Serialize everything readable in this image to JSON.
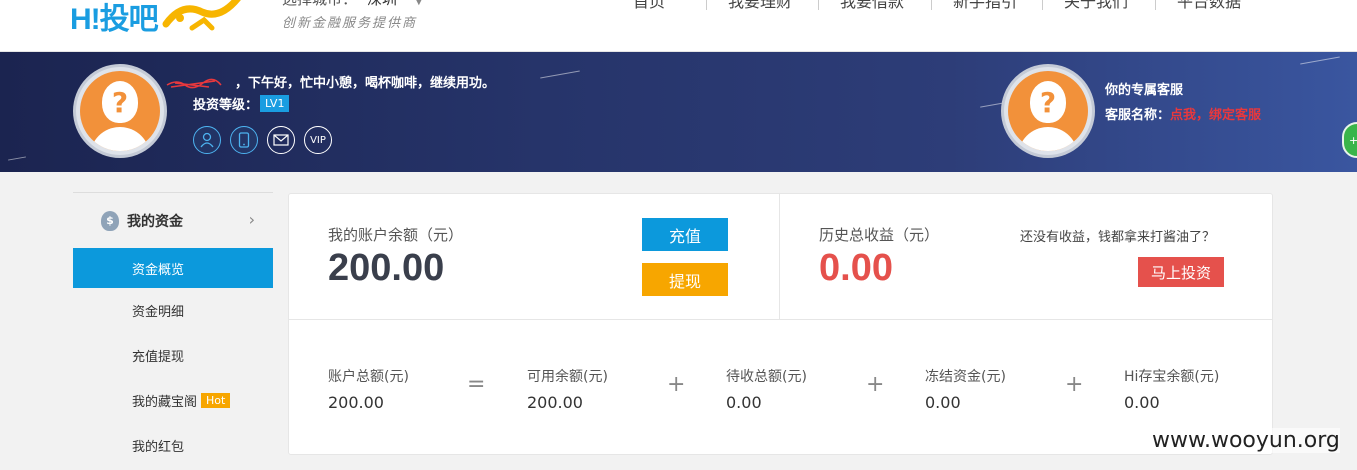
{
  "header": {
    "logo_text": "H!投吧",
    "city_label": "选择城市：",
    "city_value": "深圳",
    "slogan": "创新金融服务提供商",
    "nav": [
      "首页",
      "我要理财",
      "我要借款",
      "新手指引",
      "关于我们",
      "平台数据"
    ]
  },
  "banner": {
    "greeting": "，下午好，忙中小憩，喝杯咖啡，继续用功。",
    "level_label": "投资等级：",
    "level_value": "LV1",
    "vip_label": "VIP",
    "cs_title": "你的专属客服",
    "cs_name_label": "客服名称：",
    "cs_name_value": "点我，绑定客服",
    "side_tab": "+"
  },
  "sidebar": {
    "header": "我的资金",
    "items": [
      {
        "label": "资金概览"
      },
      {
        "label": "资金明细"
      },
      {
        "label": "充值提现"
      },
      {
        "label": "我的藏宝阁",
        "badge": "Hot"
      },
      {
        "label": "我的红包"
      }
    ]
  },
  "main": {
    "balance_label": "我的账户余额（元）",
    "balance_value": "200.00",
    "recharge_button": "充值",
    "withdraw_button": "提现",
    "earnings_label": "历史总收益（元）",
    "earnings_value": "0.00",
    "earnings_hint": "还没有收益，钱都拿来打酱油了？",
    "invest_button": "马上投资",
    "stats": [
      {
        "label": "账户总额(元)",
        "value": "200.00"
      },
      {
        "label": "可用余额(元)",
        "value": "200.00"
      },
      {
        "label": "待收总额(元)",
        "value": "0.00"
      },
      {
        "label": "冻结资金(元)",
        "value": "0.00"
      },
      {
        "label": "Hi存宝余额(元)",
        "value": "0.00"
      }
    ],
    "operators": [
      "=",
      "+",
      "+",
      "+"
    ]
  },
  "watermark": "www.wooyun.org",
  "colors": {
    "accent_blue": "#0c99dc",
    "accent_orange": "#f7a600",
    "accent_red": "#e5514c",
    "earnings_red": "#e5514c",
    "balance_dark": "#3a3f4c"
  }
}
